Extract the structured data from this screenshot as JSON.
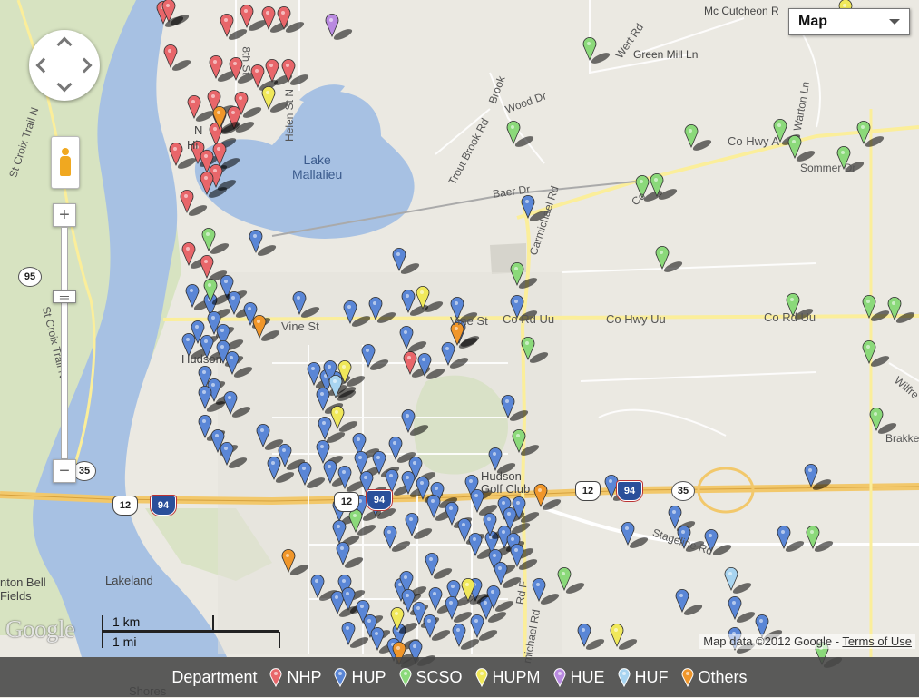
{
  "map": {
    "map_type": "Map",
    "labels": {
      "mc_cutcheon": "Mc Cutcheon R",
      "wert_rd": "Wert Rd",
      "green_mill": "Green Mill Ln",
      "st_croix_trail_n": "St Croix Trail N",
      "st_croix_trail_s": "St Croix Trail N",
      "helen_st": "Helen St N",
      "eighth_st": "8th St",
      "lake": "Lake\nMallalieu",
      "brook_rd": "Brook",
      "wood_dr": "Wood Dr",
      "trout_brook": "Trout Brook Rd",
      "baer": "Baer Dr",
      "carmichael": "Carmichael Rd",
      "co_hwy_a": "Co Hwy A",
      "sommer": "Sommer Dr",
      "co": "Co",
      "warton": "Warton Ln",
      "vine_st": "Vine St",
      "vine_st_2": "Vine St",
      "co_rd_uu": "Co Rd Uu",
      "co_hwy_uu": "Co Hwy Uu",
      "co_rd_uu_2": "Co Rd Uu",
      "hudson": "Hudson",
      "hudson_golf": "Hudson\nGolf Club",
      "stageline": "Stageline Rd",
      "lakeland": "Lakeland",
      "anton_bell": "nton Bell\nFields",
      "shores": "Shores",
      "wiffe": "Wilfre",
      "brakke": "Brakke",
      "rd_f": "Rd F",
      "michael_rd": "michael Rd",
      "ne_label": "N",
      "hi_label": "Hi"
    },
    "shields": {
      "s95": "95",
      "s35_left": "35",
      "s12_left": "12",
      "s94_left": "94",
      "s12_mid": "12",
      "s94_mid": "94",
      "s12_right": "12",
      "s94_right": "94",
      "s35_right": "35"
    }
  },
  "controls": {
    "zoom_in": "+",
    "zoom_out": "−",
    "slider_grip": "═"
  },
  "branding": {
    "google": "Google",
    "scale_km": "1 km",
    "scale_mi": "1 mi",
    "map_data": "Map data ©2012 Google -",
    "terms": "Terms of Use"
  },
  "legend": {
    "title": "Department",
    "items": [
      {
        "label": "NHP",
        "color": "#e8666a"
      },
      {
        "label": "HUP",
        "color": "#5a86d6"
      },
      {
        "label": "SCSO",
        "color": "#8bd97a"
      },
      {
        "label": "HUPM",
        "color": "#f0e85a"
      },
      {
        "label": "HUE",
        "color": "#b98ae0"
      },
      {
        "label": "HUF",
        "color": "#a8d4f0"
      },
      {
        "label": "Others",
        "color": "#f0962a"
      }
    ]
  },
  "markers": {
    "NHP": [
      [
        180,
        4
      ],
      [
        186,
        2
      ],
      [
        250,
        18
      ],
      [
        272,
        8
      ],
      [
        296,
        10
      ],
      [
        313,
        10
      ],
      [
        188,
        52
      ],
      [
        238,
        64
      ],
      [
        260,
        66
      ],
      [
        284,
        74
      ],
      [
        300,
        68
      ],
      [
        318,
        68
      ],
      [
        214,
        108
      ],
      [
        236,
        102
      ],
      [
        266,
        104
      ],
      [
        242,
        122
      ],
      [
        258,
        120
      ],
      [
        238,
        138
      ],
      [
        218,
        158
      ],
      [
        242,
        160
      ],
      [
        194,
        160
      ],
      [
        228,
        168
      ],
      [
        238,
        184
      ],
      [
        228,
        192
      ],
      [
        206,
        212
      ],
      [
        208,
        270
      ],
      [
        228,
        284
      ],
      [
        452,
        390
      ]
    ],
    "HUP": [
      [
        582,
        218
      ],
      [
        282,
        256
      ],
      [
        440,
        276
      ],
      [
        212,
        316
      ],
      [
        250,
        306
      ],
      [
        232,
        326
      ],
      [
        258,
        324
      ],
      [
        276,
        336
      ],
      [
        330,
        324
      ],
      [
        386,
        334
      ],
      [
        414,
        330
      ],
      [
        450,
        322
      ],
      [
        504,
        330
      ],
      [
        570,
        328
      ],
      [
        218,
        356
      ],
      [
        236,
        346
      ],
      [
        246,
        360
      ],
      [
        208,
        370
      ],
      [
        228,
        372
      ],
      [
        246,
        378
      ],
      [
        256,
        390
      ],
      [
        346,
        402
      ],
      [
        360,
        410
      ],
      [
        406,
        382
      ],
      [
        448,
        362
      ],
      [
        468,
        392
      ],
      [
        494,
        380
      ],
      [
        506,
        356
      ],
      [
        226,
        406
      ],
      [
        236,
        420
      ],
      [
        226,
        428
      ],
      [
        254,
        434
      ],
      [
        356,
        430
      ],
      [
        370,
        412
      ],
      [
        364,
        400
      ],
      [
        450,
        454
      ],
      [
        560,
        438
      ],
      [
        226,
        460
      ],
      [
        240,
        476
      ],
      [
        250,
        490
      ],
      [
        290,
        470
      ],
      [
        358,
        462
      ],
      [
        396,
        480
      ],
      [
        436,
        484
      ],
      [
        302,
        506
      ],
      [
        314,
        492
      ],
      [
        336,
        512
      ],
      [
        356,
        488
      ],
      [
        364,
        510
      ],
      [
        380,
        516
      ],
      [
        398,
        500
      ],
      [
        404,
        522
      ],
      [
        418,
        500
      ],
      [
        432,
        520
      ],
      [
        458,
        506
      ],
      [
        450,
        522
      ],
      [
        466,
        528
      ],
      [
        482,
        534
      ],
      [
        520,
        526
      ],
      [
        546,
        496
      ],
      [
        526,
        542
      ],
      [
        556,
        550
      ],
      [
        572,
        550
      ],
      [
        562,
        562
      ],
      [
        374,
        552
      ],
      [
        374,
        576
      ],
      [
        398,
        548
      ],
      [
        414,
        546
      ],
      [
        430,
        582
      ],
      [
        454,
        568
      ],
      [
        478,
        548
      ],
      [
        498,
        556
      ],
      [
        512,
        574
      ],
      [
        524,
        590
      ],
      [
        542,
        588
      ],
      [
        540,
        568
      ],
      [
        556,
        582
      ],
      [
        566,
        590
      ],
      [
        570,
        602
      ],
      [
        546,
        608
      ],
      [
        552,
        622
      ],
      [
        378,
        600
      ],
      [
        476,
        612
      ],
      [
        350,
        636
      ],
      [
        372,
        654
      ],
      [
        380,
        636
      ],
      [
        384,
        650
      ],
      [
        400,
        664
      ],
      [
        408,
        680
      ],
      [
        416,
        694
      ],
      [
        384,
        688
      ],
      [
        442,
        640
      ],
      [
        448,
        632
      ],
      [
        450,
        652
      ],
      [
        462,
        666
      ],
      [
        480,
        650
      ],
      [
        500,
        642
      ],
      [
        498,
        660
      ],
      [
        524,
        640
      ],
      [
        536,
        660
      ],
      [
        544,
        648
      ],
      [
        474,
        680
      ],
      [
        506,
        690
      ],
      [
        526,
        680
      ],
      [
        594,
        640
      ],
      [
        440,
        690
      ],
      [
        434,
        706
      ],
      [
        458,
        708
      ],
      [
        470,
        718
      ],
      [
        484,
        724
      ],
      [
        674,
        526
      ],
      [
        744,
        560
      ],
      [
        692,
        578
      ],
      [
        754,
        582
      ],
      [
        784,
        586
      ],
      [
        864,
        582
      ],
      [
        894,
        514
      ],
      [
        752,
        652
      ],
      [
        810,
        660
      ],
      [
        840,
        680
      ],
      [
        810,
        694
      ],
      [
        674,
        720
      ],
      [
        644,
        690
      ]
    ],
    "SCSO": [
      [
        650,
        44
      ],
      [
        566,
        136
      ],
      [
        762,
        140
      ],
      [
        860,
        134
      ],
      [
        876,
        152
      ],
      [
        952,
        136
      ],
      [
        930,
        164
      ],
      [
        708,
        196
      ],
      [
        724,
        194
      ],
      [
        230,
        254
      ],
      [
        730,
        274
      ],
      [
        570,
        292
      ],
      [
        232,
        310
      ],
      [
        874,
        326
      ],
      [
        958,
        328
      ],
      [
        986,
        330
      ],
      [
        582,
        374
      ],
      [
        958,
        378
      ],
      [
        966,
        452
      ],
      [
        572,
        476
      ],
      [
        392,
        564
      ],
      [
        896,
        582
      ],
      [
        622,
        628
      ],
      [
        906,
        710
      ]
    ],
    "HUPM": [
      [
        932,
        2
      ],
      [
        296,
        98
      ],
      [
        466,
        318
      ],
      [
        380,
        400
      ],
      [
        372,
        450
      ],
      [
        516,
        640
      ],
      [
        438,
        672
      ],
      [
        680,
        690
      ]
    ],
    "HUE": [
      [
        366,
        18
      ]
    ],
    "HUF": [
      [
        370,
        416
      ],
      [
        806,
        628
      ]
    ],
    "Others": [
      [
        242,
        120
      ],
      [
        286,
        350
      ],
      [
        504,
        358
      ],
      [
        596,
        536
      ],
      [
        318,
        608
      ],
      [
        440,
        710
      ]
    ]
  }
}
